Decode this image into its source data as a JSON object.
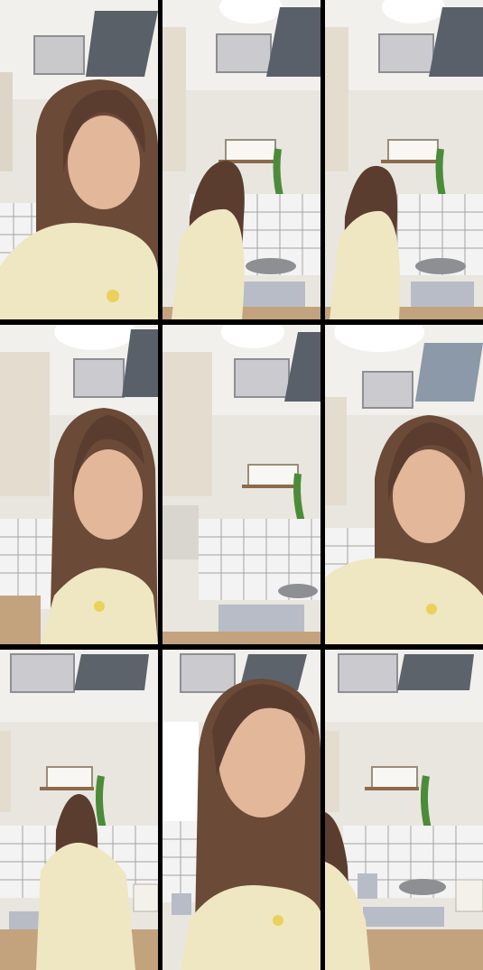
{
  "collage": {
    "layout": "3x3",
    "frames": [
      {
        "scene": "selfie-closeup"
      },
      {
        "scene": "back-at-stove"
      },
      {
        "scene": "back-at-stove"
      },
      {
        "scene": "selfie-smile"
      },
      {
        "scene": "kitchen-empty"
      },
      {
        "scene": "selfie-closeup"
      },
      {
        "scene": "back-at-stove"
      },
      {
        "scene": "selfie-closeup"
      },
      {
        "scene": "kitchen-side"
      }
    ]
  },
  "colors": {
    "background": "#000000",
    "wall": "#e9e6e0",
    "ceiling": "#f1efea",
    "hair": "#6b4a38",
    "shirt": "#efe6c2",
    "skin": "#e2b79a",
    "tile_grid": "#a5a3a0",
    "plant": "#4c8b3a",
    "stove": "#b8bcc6"
  }
}
